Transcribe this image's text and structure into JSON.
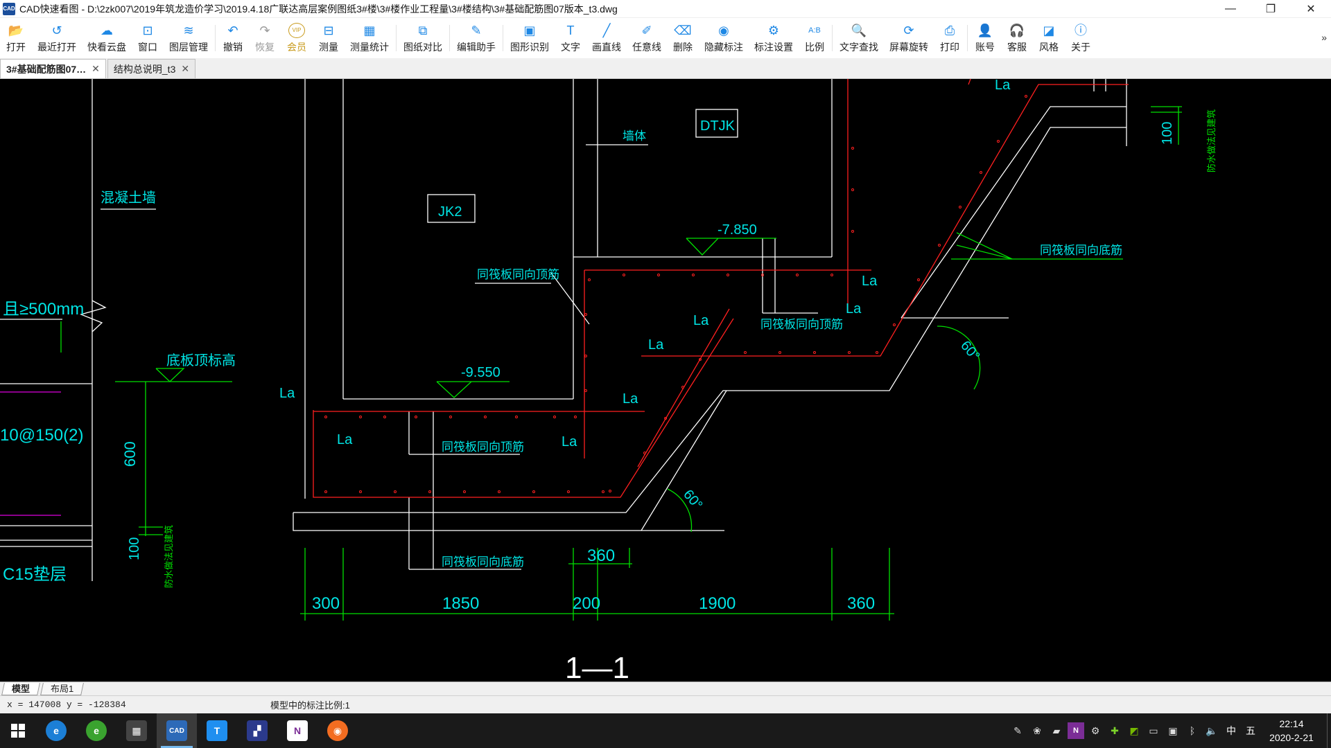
{
  "window": {
    "app_icon_text": "CAD",
    "title": "CAD快速看图 - D:\\2zk007\\2019年筑龙造价学习\\2019.4.18广联达高层案例图纸3#楼\\3#楼作业工程量\\3#楼结构\\3#基础配筋图07版本_t3.dwg",
    "minimize": "—",
    "restore": "❐",
    "close": "✕"
  },
  "toolbar": {
    "more": "»",
    "items": [
      {
        "label": "打开",
        "icon": "folder-icon",
        "glyph": "📂"
      },
      {
        "label": "最近打开",
        "icon": "history-icon",
        "glyph": "↺"
      },
      {
        "label": "快看云盘",
        "icon": "cloud-icon",
        "glyph": "☁"
      },
      {
        "label": "窗口",
        "icon": "window-icon",
        "glyph": "⊡"
      },
      {
        "label": "图层管理",
        "icon": "layers-icon",
        "glyph": "≋"
      },
      {
        "label": "撤销",
        "icon": "undo-icon",
        "glyph": "↶"
      },
      {
        "label": "恢复",
        "icon": "redo-icon",
        "glyph": "↷"
      },
      {
        "label": "会员",
        "icon": "vip-icon",
        "glyph": "VIP"
      },
      {
        "label": "测量",
        "icon": "ruler-icon",
        "glyph": "⊟"
      },
      {
        "label": "测量统计",
        "icon": "measure-stats-icon",
        "glyph": "▦"
      },
      {
        "label": "图纸对比",
        "icon": "compare-icon",
        "glyph": "⧉"
      },
      {
        "label": "编辑助手",
        "icon": "edit-assistant-icon",
        "glyph": "✎"
      },
      {
        "label": "图形识别",
        "icon": "shape-recognition-icon",
        "glyph": "▣"
      },
      {
        "label": "文字",
        "icon": "text-icon",
        "glyph": "T"
      },
      {
        "label": "画直线",
        "icon": "line-icon",
        "glyph": "╱"
      },
      {
        "label": "任意线",
        "icon": "freehand-icon",
        "glyph": "✐"
      },
      {
        "label": "删除",
        "icon": "eraser-icon",
        "glyph": "⌫"
      },
      {
        "label": "隐藏标注",
        "icon": "eye-hide-icon",
        "glyph": "◉"
      },
      {
        "label": "标注设置",
        "icon": "annotation-settings-icon",
        "glyph": "⚙"
      },
      {
        "label": "比例",
        "icon": "scale-icon",
        "glyph": "A:B"
      },
      {
        "label": "文字查找",
        "icon": "text-search-icon",
        "glyph": "🔍"
      },
      {
        "label": "屏幕旋转",
        "icon": "rotate-screen-icon",
        "glyph": "⟳"
      },
      {
        "label": "打印",
        "icon": "printer-icon",
        "glyph": "⎙"
      },
      {
        "label": "账号",
        "icon": "user-icon",
        "glyph": "👤"
      },
      {
        "label": "客服",
        "icon": "headset-icon",
        "glyph": "🎧"
      },
      {
        "label": "风格",
        "icon": "style-icon",
        "glyph": "◪"
      },
      {
        "label": "关于",
        "icon": "info-icon",
        "glyph": "ⓘ"
      }
    ]
  },
  "tabs": [
    {
      "label": "3#基础配筋图07…",
      "close": "✕",
      "active": true
    },
    {
      "label": "结构总说明_t3",
      "close": "✕",
      "active": false
    }
  ],
  "drawing": {
    "labels": {
      "concrete_wall": "混凝土墙",
      "gt500": "且≥500mm",
      "slab_top_elev": "底板顶标高",
      "rebar_spec": "10@150(2)",
      "dim_600": "600",
      "dim_100_left": "100",
      "waterproof_left": "防水做法见建筑",
      "c15_cushion": "C15垫层",
      "jk2": "JK2",
      "dtjk": "DTJK",
      "wall": "墙体",
      "elev_7850": "-7.850",
      "elev_9550": "-9.550",
      "top_rebar_1": "同筏板同向顶筋",
      "top_rebar_2": "同筏板同向顶筋",
      "top_rebar_3": "同筏板同向顶筋",
      "bottom_rebar_1": "同筏板同向底筋",
      "bottom_rebar_2": "同筏板同向底筋",
      "la": "La",
      "angle_60": "60°",
      "dim_100_right": "100",
      "waterproof_right": "防水做法见建筑",
      "section": "1—1"
    },
    "dimensions": [
      "300",
      "1850",
      "200",
      "1900",
      "360"
    ],
    "dim_top_360": "360"
  },
  "layout_tabs": [
    {
      "label": "模型",
      "active": true
    },
    {
      "label": "布局1",
      "active": false
    }
  ],
  "status": {
    "coords": "x = 147008  y = -128384",
    "scale_note": "模型中的标注比例:1"
  },
  "taskbar": {
    "apps": [
      {
        "name": "windows-start",
        "glyph": "⊞"
      },
      {
        "name": "internet-explorer",
        "glyph": "e"
      },
      {
        "name": "browser-360",
        "glyph": "e"
      },
      {
        "name": "calculator",
        "glyph": "▦"
      },
      {
        "name": "cad-viewer",
        "glyph": "CAD"
      },
      {
        "name": "text-app",
        "glyph": "T"
      },
      {
        "name": "remote-app",
        "glyph": "▞"
      },
      {
        "name": "onenote",
        "glyph": "N"
      },
      {
        "name": "firefox",
        "glyph": "◉"
      }
    ],
    "tray": [
      "ime-icon",
      "tray-app-1",
      "tray-app-2",
      "onenote-tray",
      "steam-icon",
      "tray-app-3",
      "nvidia-icon",
      "battery-icon",
      "display-icon",
      "bluetooth-icon",
      "volume-icon"
    ],
    "ime": "中",
    "ime_mode": "五",
    "time": "22:14",
    "date": "2020-2-21"
  },
  "colors": {
    "canvas_bg": "#000000",
    "cad_white": "#ffffff",
    "cad_red": "#ff2020",
    "cad_green": "#00e000",
    "cad_cyan": "#00e5e5",
    "cad_magenta": "#e000e0"
  }
}
